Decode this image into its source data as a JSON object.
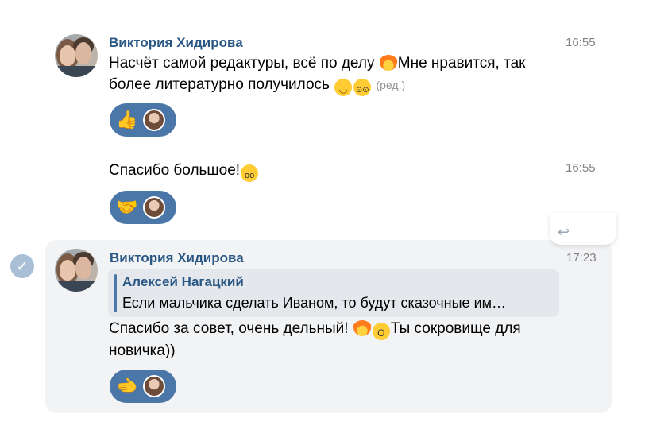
{
  "messages": [
    {
      "author": "Виктория Хидирова",
      "time": "16:55",
      "text_line1_a": "Насчёт самой редактуры, всё по делу ",
      "text_line1_b": "Мне нравится, так",
      "text_line2": "более литературно получилось ",
      "edited": "(ред.)",
      "reaction_emoji": "👍"
    },
    {
      "time": "16:55",
      "text": "Спасибо большое!",
      "reaction_emoji": "🤝"
    },
    {
      "author": "Виктория Хидирова",
      "time": "17:23",
      "reply_author": "Алексей Нагацкий",
      "reply_text": "Если мальчика сделать Иваном, то будут сказочные им…",
      "text_line1_a": "Спасибо за совет, очень дельный! ",
      "text_line1_b": "Ты сокровище для",
      "text_line2": "новичка))",
      "reaction_emoji": "🫲"
    }
  ],
  "icons": {
    "check": "✓",
    "toolbar": "↩"
  }
}
